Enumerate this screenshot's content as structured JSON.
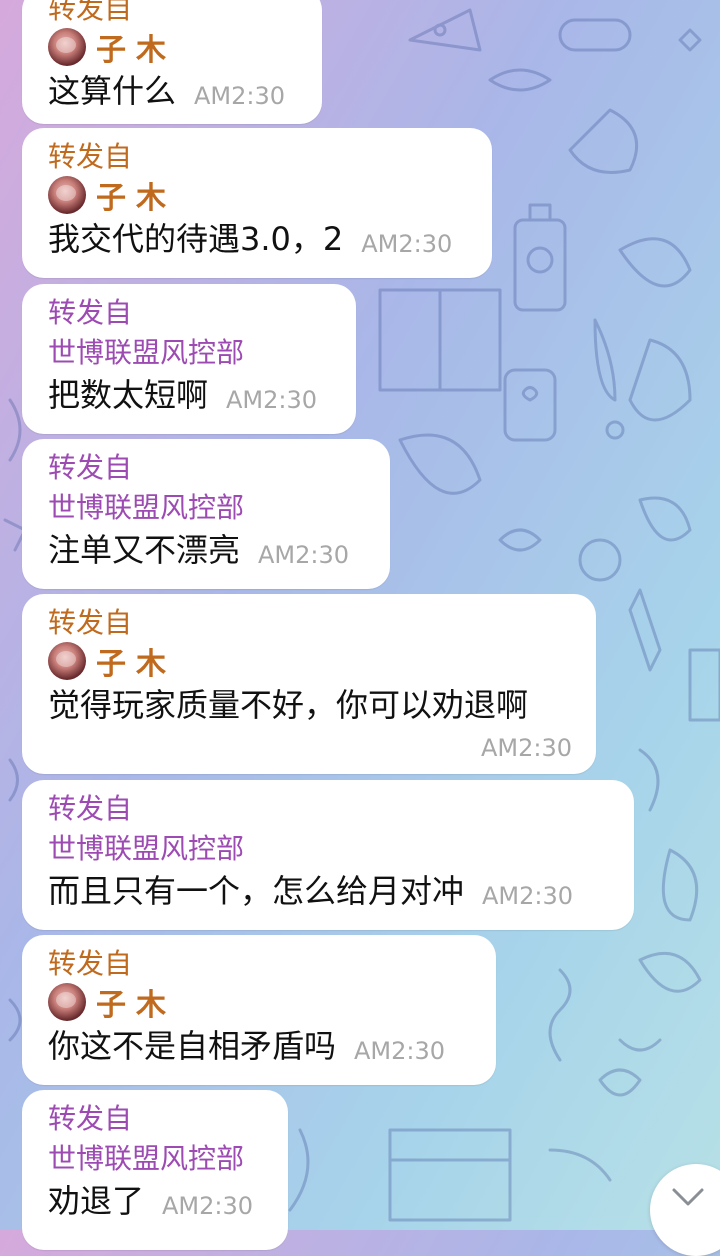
{
  "messages": [
    {
      "label": "转发自",
      "sender": "子木",
      "sender_type": "user",
      "text": "这算什么",
      "time": "AM2:30"
    },
    {
      "label": "转发自",
      "sender": "子木",
      "sender_type": "user",
      "text": "我交代的待遇3.0，2",
      "time": "AM2:30"
    },
    {
      "label": "转发自",
      "sender": "世博联盟风控部",
      "sender_type": "channel",
      "text": "把数太短啊",
      "time": "AM2:30"
    },
    {
      "label": "转发自",
      "sender": "世博联盟风控部",
      "sender_type": "channel",
      "text": "注单又不漂亮",
      "time": "AM2:30"
    },
    {
      "label": "转发自",
      "sender": "子木",
      "sender_type": "user",
      "text": "觉得玩家质量不好，你可以劝退啊",
      "time": "AM2:30"
    },
    {
      "label": "转发自",
      "sender": "世博联盟风控部",
      "sender_type": "channel",
      "text": "而且只有一个，怎么给月对冲",
      "time": "AM2:30"
    },
    {
      "label": "转发自",
      "sender": "子木",
      "sender_type": "user",
      "text": "你这不是自相矛盾吗",
      "time": "AM2:30"
    },
    {
      "label": "转发自",
      "sender": "世博联盟风控部",
      "sender_type": "channel",
      "text": "劝退了",
      "time": "AM2:30"
    }
  ],
  "colors": {
    "forward_label_orange": "#c06a1e",
    "forward_label_purple": "#9d4bb3",
    "time_gray": "#a7a7a7",
    "bubble_bg": "#ffffff"
  },
  "icons": {
    "scroll_down": "chevron-down-icon",
    "avatar": "avatar"
  }
}
